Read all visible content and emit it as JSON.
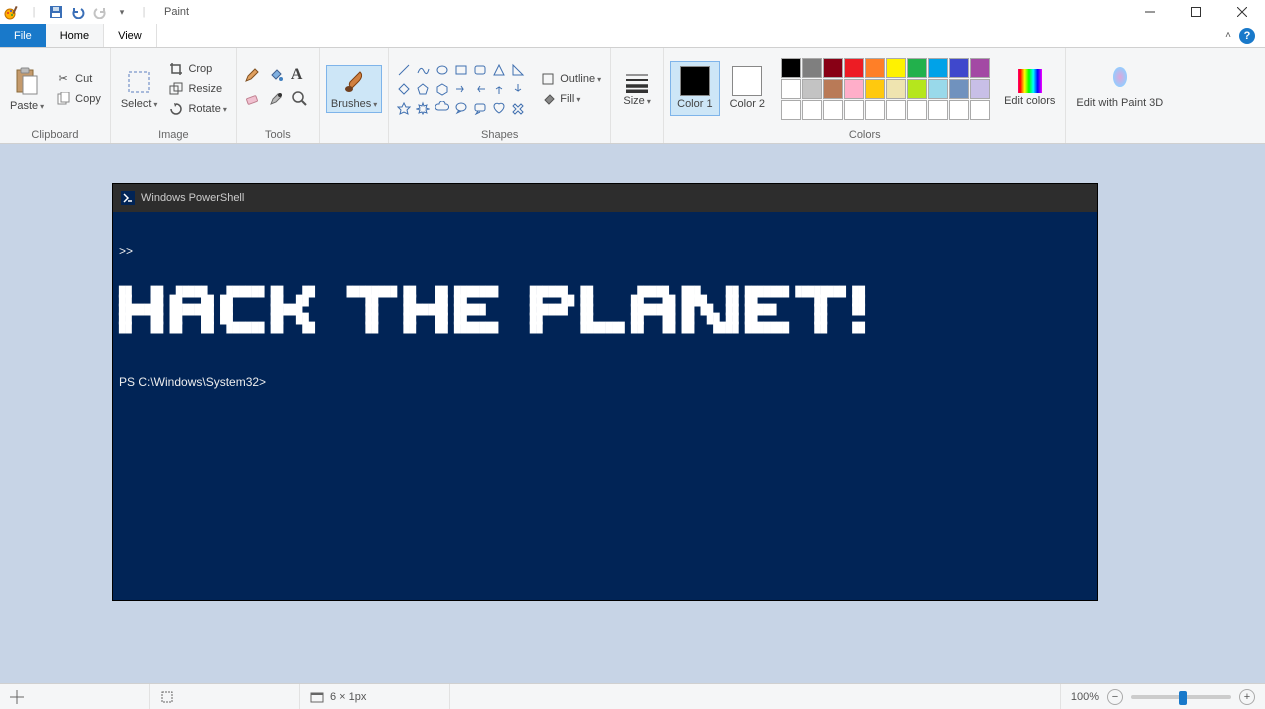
{
  "app": {
    "title": "Paint"
  },
  "tabs": {
    "file": "File",
    "home": "Home",
    "view": "View"
  },
  "ribbon": {
    "clipboard": {
      "label": "Clipboard",
      "paste": "Paste",
      "cut": "Cut",
      "copy": "Copy"
    },
    "image": {
      "label": "Image",
      "select": "Select",
      "crop": "Crop",
      "resize": "Resize",
      "rotate": "Rotate"
    },
    "tools": {
      "label": "Tools"
    },
    "brushes": {
      "label": "Brushes"
    },
    "shapes": {
      "label": "Shapes",
      "outline": "Outline",
      "fill": "Fill"
    },
    "size": {
      "label": "Size"
    },
    "colors": {
      "label": "Colors",
      "color1": "Color 1",
      "color2": "Color 2",
      "edit": "Edit colors",
      "row1": [
        "#000000",
        "#7f7f7f",
        "#880015",
        "#ed1c24",
        "#ff7f27",
        "#fff200",
        "#22b14c",
        "#00a2e8",
        "#3f48cc",
        "#a349a4"
      ],
      "row2": [
        "#ffffff",
        "#c3c3c3",
        "#b97a57",
        "#ffaec9",
        "#ffc90e",
        "#efe4b0",
        "#b5e61d",
        "#99d9ea",
        "#7092be",
        "#c8bfe7"
      ],
      "row3": [
        "#ffffff",
        "#ffffff",
        "#ffffff",
        "#ffffff",
        "#ffffff",
        "#ffffff",
        "#ffffff",
        "#ffffff",
        "#ffffff",
        "#ffffff"
      ],
      "c1_value": "#000000",
      "c2_value": "#ffffff"
    },
    "paint3d": {
      "label": "Edit with Paint 3D"
    }
  },
  "canvas": {
    "ps_title": "Windows PowerShell",
    "prompt_marker": ">>",
    "ascii": "██   ██  █████   ██████ ██   ██     ████████ ██   ██ ███████     ██████  ██       █████  ███    ██ ███████ ████████ ██\n██   ██ ██   ██ ██      ██  ██         ██    ██   ██ ██          ██   ██ ██      ██   ██ ████   ██ ██         ██    ██\n███████ ███████ ██      █████          ██    ███████ █████       ██████  ██      ███████ ██ ██  ██ █████      ██    ██\n██   ██ ██   ██ ██      ██  ██         ██    ██   ██ ██          ██      ██      ██   ██ ██  ██ ██ ██         ██      \n██   ██ ██   ██  ██████ ██   ██        ██    ██   ██ ███████     ██      ███████ ██   ██ ██   ████ ███████    ██    ██",
    "prompt": "PS C:\\Windows\\System32>"
  },
  "status": {
    "dimensions": "6 × 1px",
    "zoom": "100%"
  }
}
